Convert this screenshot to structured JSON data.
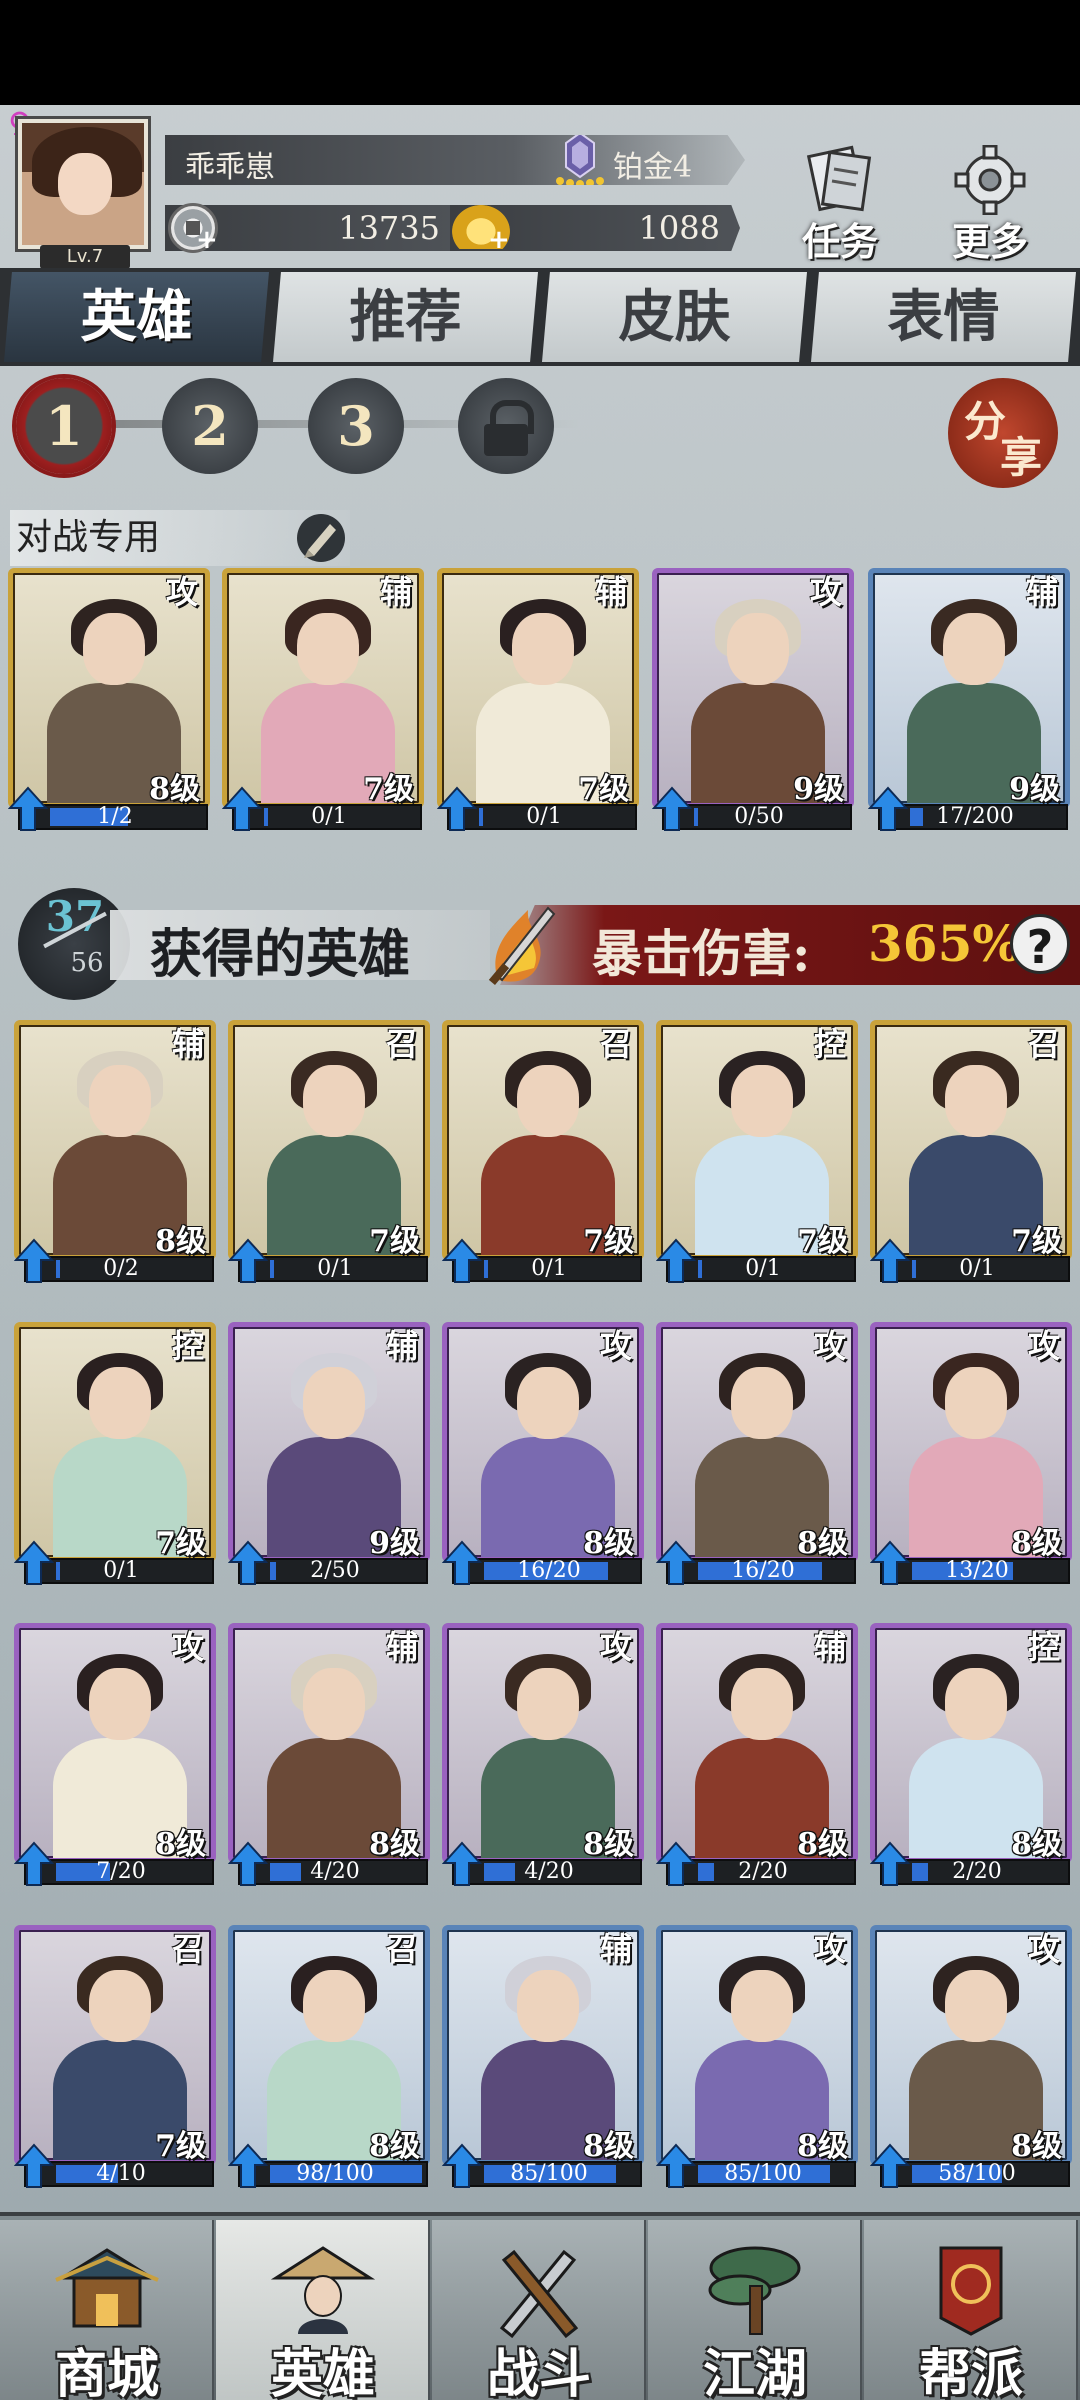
{
  "player": {
    "name": "乖乖崽",
    "level": "Lv.7",
    "rank": "铂金4",
    "coins": "13735",
    "gold": "1088"
  },
  "top_buttons": {
    "tasks": "任务",
    "more": "更多"
  },
  "tabs": [
    "英雄",
    "推荐",
    "皮肤",
    "表情"
  ],
  "squads": {
    "items": [
      "1",
      "2",
      "3"
    ],
    "active": "1",
    "share": "分享"
  },
  "battle": {
    "label": "对战专用",
    "cards": [
      {
        "role": "攻",
        "level": "8级",
        "progress": "1/2",
        "fill": 0.5,
        "frame": "gold"
      },
      {
        "role": "辅",
        "level": "7级",
        "progress": "0/1",
        "fill": 0,
        "frame": "gold"
      },
      {
        "role": "辅",
        "level": "7级",
        "progress": "0/1",
        "fill": 0,
        "frame": "gold"
      },
      {
        "role": "攻",
        "level": "9级",
        "progress": "0/50",
        "fill": 0,
        "frame": "purple"
      },
      {
        "role": "辅",
        "level": "9级",
        "progress": "17/200",
        "fill": 0.085,
        "frame": "blue"
      }
    ]
  },
  "obtained": {
    "count": "37",
    "total": "56",
    "title": "获得的英雄",
    "crit_label": "暴击伤害:",
    "crit_value": "365%",
    "help": "?",
    "cards": [
      {
        "role": "辅",
        "level": "8级",
        "progress": "0/2",
        "fill": 0,
        "frame": "gold"
      },
      {
        "role": "召",
        "level": "7级",
        "progress": "0/1",
        "fill": 0,
        "frame": "gold"
      },
      {
        "role": "召",
        "level": "7级",
        "progress": "0/1",
        "fill": 0,
        "frame": "gold"
      },
      {
        "role": "控",
        "level": "7级",
        "progress": "0/1",
        "fill": 0,
        "frame": "gold"
      },
      {
        "role": "召",
        "level": "7级",
        "progress": "0/1",
        "fill": 0,
        "frame": "gold"
      },
      {
        "role": "控",
        "level": "7级",
        "progress": "0/1",
        "fill": 0,
        "frame": "gold"
      },
      {
        "role": "辅",
        "level": "9级",
        "progress": "2/50",
        "fill": 0.04,
        "frame": "purple"
      },
      {
        "role": "攻",
        "level": "8级",
        "progress": "16/20",
        "fill": 0.8,
        "frame": "purple"
      },
      {
        "role": "攻",
        "level": "8级",
        "progress": "16/20",
        "fill": 0.8,
        "frame": "purple"
      },
      {
        "role": "攻",
        "level": "8级",
        "progress": "13/20",
        "fill": 0.65,
        "frame": "purple"
      },
      {
        "role": "攻",
        "level": "8级",
        "progress": "7/20",
        "fill": 0.35,
        "frame": "purple"
      },
      {
        "role": "辅",
        "level": "8级",
        "progress": "4/20",
        "fill": 0.2,
        "frame": "purple"
      },
      {
        "role": "攻",
        "level": "8级",
        "progress": "4/20",
        "fill": 0.2,
        "frame": "purple"
      },
      {
        "role": "辅",
        "level": "8级",
        "progress": "2/20",
        "fill": 0.1,
        "frame": "purple"
      },
      {
        "role": "控",
        "level": "8级",
        "progress": "2/20",
        "fill": 0.1,
        "frame": "purple"
      },
      {
        "role": "召",
        "level": "7级",
        "progress": "4/10",
        "fill": 0.4,
        "frame": "purple"
      },
      {
        "role": "召",
        "level": "8级",
        "progress": "98/100",
        "fill": 0.98,
        "frame": "blue"
      },
      {
        "role": "辅",
        "level": "8级",
        "progress": "85/100",
        "fill": 0.85,
        "frame": "blue"
      },
      {
        "role": "攻",
        "level": "8级",
        "progress": "85/100",
        "fill": 0.85,
        "frame": "blue"
      },
      {
        "role": "攻",
        "level": "8级",
        "progress": "58/100",
        "fill": 0.58,
        "frame": "blue"
      }
    ]
  },
  "bottom_nav": {
    "items": [
      "商城",
      "英雄",
      "战斗",
      "江湖",
      "帮派"
    ],
    "active": "英雄"
  },
  "colors": {
    "gold_frame": "#c9a23a",
    "purple_frame": "#9a62c0",
    "blue_frame": "#5a84b8",
    "progress_fill": "#2f6fd6",
    "crit_value": "#f5c637",
    "count": "#6bc3d3"
  }
}
